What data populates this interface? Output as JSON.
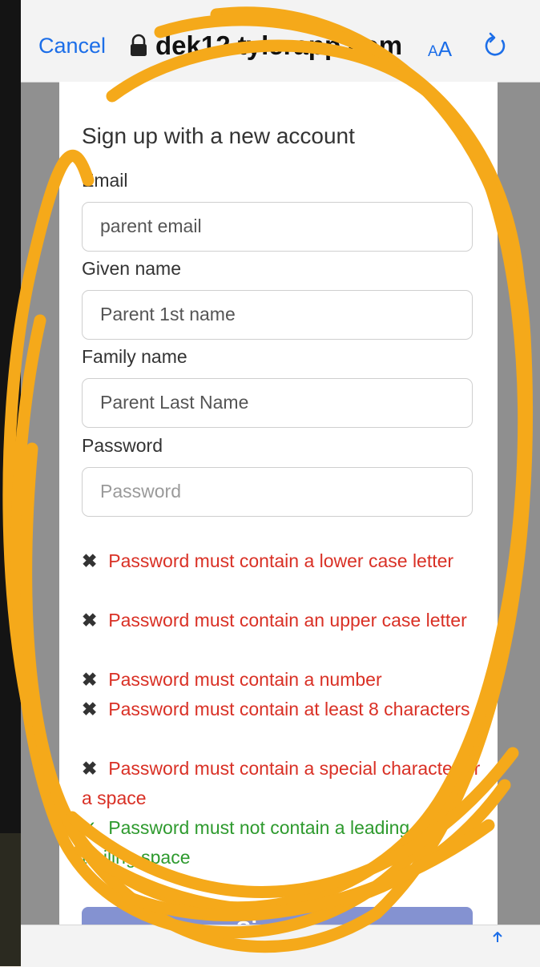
{
  "browser": {
    "cancel_label": "Cancel",
    "url": "dek12.tylerapp.com",
    "aa_small": "A",
    "aa_big": "A"
  },
  "form": {
    "heading": "Sign up with a new account",
    "fields": [
      {
        "label": "Email",
        "value": "parent email"
      },
      {
        "label": "Given name",
        "value": "Parent 1st name"
      },
      {
        "label": "Family name",
        "value": "Parent Last Name"
      },
      {
        "label": "Password",
        "placeholder": "Password"
      }
    ],
    "requirements": [
      {
        "mark": "✖",
        "text": "Password must contain a lower case letter",
        "status": "fail"
      },
      {
        "mark": "✖",
        "text": "Password must contain an upper case letter",
        "status": "fail"
      },
      {
        "mark": "✖",
        "text": "Password must contain a number",
        "status": "fail"
      },
      {
        "mark": "✖",
        "text": "Password must contain at least 8 characters",
        "status": "fail"
      },
      {
        "mark": "✖",
        "text": "Password must contain a special character or a space",
        "status": "fail"
      },
      {
        "mark": "✓",
        "text": "Password must not contain a leading or trailing space",
        "status": "pass"
      }
    ],
    "submit_label": "Sign up"
  },
  "colors": {
    "link_blue": "#1c6ee8",
    "error_red": "#d93025",
    "success_green": "#2e9a2e",
    "button": "#8492d1",
    "scribble_orange": "#f5a91a"
  }
}
